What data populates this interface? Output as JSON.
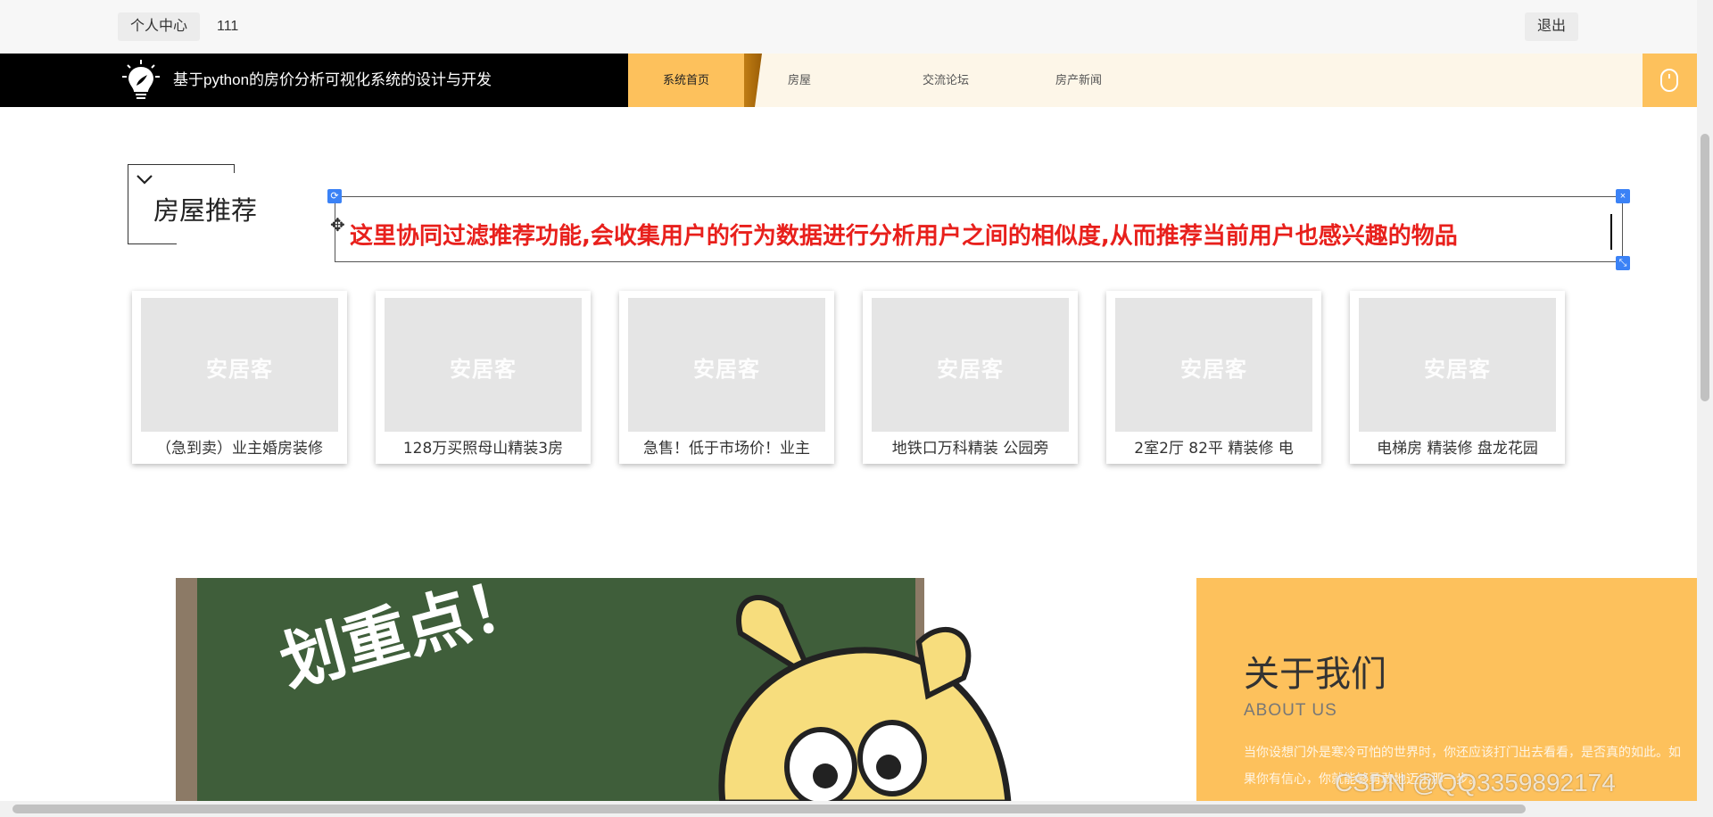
{
  "topbar": {
    "profile_label": "个人中心",
    "username": "111",
    "logout_label": "退出"
  },
  "nav": {
    "site_title": "基于python的房价分析可视化系统的设计与开发",
    "items": [
      {
        "label": "系统首页",
        "active": true
      },
      {
        "label": "房屋",
        "active": false
      },
      {
        "label": "交流论坛",
        "active": false
      },
      {
        "label": "房产新闻",
        "active": false
      }
    ],
    "accent_color": "#fdc15c"
  },
  "section": {
    "title": "房屋推荐"
  },
  "annotation": {
    "text": "这里协同过滤推荐功能,会收集用户的行为数据进行分析用户之间的相似度,从而推荐当前用户也感兴趣的物品",
    "color": "#e8201c",
    "close_symbol": "×"
  },
  "houses": [
    {
      "image_text": "安居客",
      "title": "（急到卖）业主婚房装修"
    },
    {
      "image_text": "安居客",
      "title": "128万买照母山精装3房"
    },
    {
      "image_text": "安居客",
      "title": "急售！低于市场价！业主"
    },
    {
      "image_text": "安居客",
      "title": "地铁口万科精装 公园旁"
    },
    {
      "image_text": "安居客",
      "title": "2室2厅 82平 精装修 电"
    },
    {
      "image_text": "安居客",
      "title": "电梯房 精装修 盘龙花园"
    }
  ],
  "banner": {
    "board_text": "划重点！"
  },
  "about": {
    "title": "关于我们",
    "subtitle": "ABOUT US",
    "text": "当你设想门外是寒冷可怕的世界时，你还应该打门出去看看，是否真的如此。如果你有信心，你就能够勇敢地迈出那一步。"
  },
  "watermark": "CSDN @QQ3359892174"
}
